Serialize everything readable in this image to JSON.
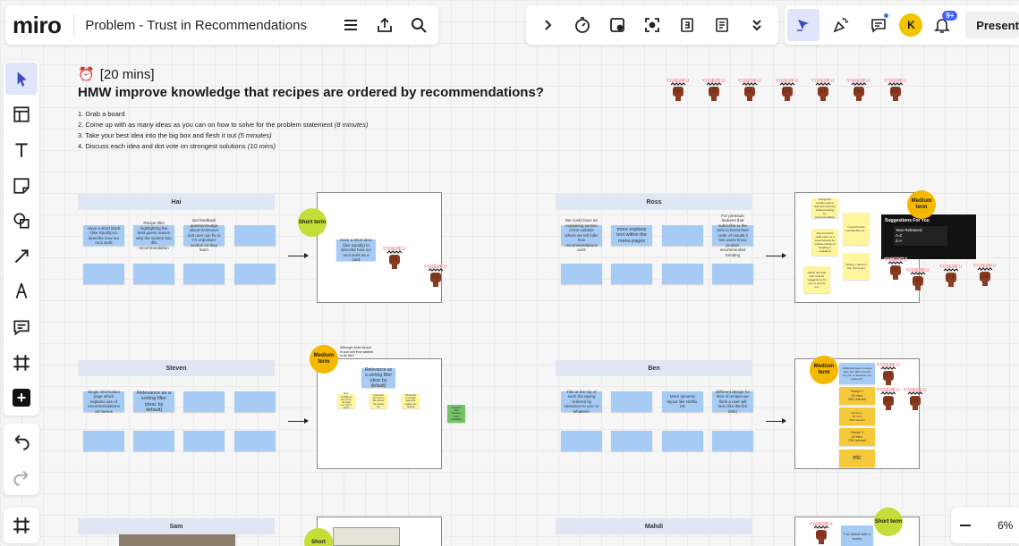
{
  "topbar": {
    "logo": "miro",
    "board_title": "Problem - Trust in Recommendations",
    "avatar_initial": "K",
    "notif_badge": "9+",
    "present_label": "Present"
  },
  "board": {
    "timer": "[20 mins]",
    "heading": "HMW improve knowledge that recipes are ordered by recommendations?",
    "steps": [
      {
        "text": "1. Grab a board",
        "em": ""
      },
      {
        "text": "2. Come up with as many ideas as you can on how to solve for the problem statement ",
        "em": "(8 minutes)"
      },
      {
        "text": "3. Take your best idea into the big box and flesh it out ",
        "em": "(5 minutes)"
      },
      {
        "text": "4. Discuss each idea and dot vote on strongest solutions ",
        "em": "(10 mins)"
      }
    ],
    "powerful_label": "POWERFUL",
    "sections": {
      "hai": {
        "name": "Hai",
        "stickies": [
          "Have a short blurb (like Spotify) to describe how our recs work",
          "Recipe tiles highlighting the best guess reason why the system has this recommendation",
          "Get feedback question/nudge about freshness and user can fix to 'It's important' section so they learn",
          ""
        ],
        "box_sticky": "Have a short desc (like Spotify) to describe how our recs work as a card",
        "tag": "Short term"
      },
      "ross": {
        "name": "Ross",
        "stickies": [
          "We could have an explaining section of the website where we tell folks how recommendations work",
          "more explany text within the menu pages",
          "",
          "For premium features that subscribe to the rank to boost their order of results it lets users know product recommended trending"
        ],
        "tag": "Medium term",
        "box_stickies": [
          "Using tech overlay options that flow back the defined ranking by recommendation",
          "It would be the one that Bon so...",
          "This should be really clear as it would already be intuitive without a heading or explained",
          "Sorting + filters in the 'You've got",
          "Netflix has their own rank for 'suggestions for you' or 'just for me'",
          "nice"
        ],
        "screen_title": "Suggestions For You",
        "screen_lines": [
          "Year Released",
          "A-Z",
          "Z-A"
        ]
      },
      "steven": {
        "name": "Steven",
        "stickies": [
          "Single information page which explains use of recommendations on menus",
          "Relevance as a sorting filter (desc by default)",
          "",
          ""
        ],
        "tag": "Medium term",
        "box_note": "Although could we just re-use sort if we wanted to do this?",
        "box_sticky": "Relevance as a sorting filter (desc by default)",
        "yellow_stickies": [
          "More visibility of the sort on the page e.g. top of menu",
          "Could add 'sort' item to filter across the sorting list",
          "Would link to a single page that explains the ranking",
          "Evidence that showing it helps knowledge"
        ]
      },
      "ben": {
        "name": "Ben",
        "stickies": [
          "Title at the top of each list saying 'ordered by relevance to you' or whatever",
          "",
          "More dynamic layout like Netflix, etc",
          "Different design for tiles of recipes we think a user will love (like the fire dots)"
        ],
        "tag": "Medium term",
        "recipes": [
          "Additional tags on recipe tiles, like '90% relevant for you' or 'because you ordered X'",
          "Recipe 1\n95 mins\n98% relevant",
          "Recipe 2\n30 mins\n80% relevant",
          "Recipe 3\n20 mins\n75% relevant",
          "etc"
        ]
      },
      "sam": {
        "name": "Sam",
        "tag": "Short"
      },
      "mahdi": {
        "name": "Mahdi",
        "tag": "Short term",
        "sticky": "For Mahdi with a tooltip"
      }
    }
  },
  "zoom": {
    "label": "6%"
  }
}
